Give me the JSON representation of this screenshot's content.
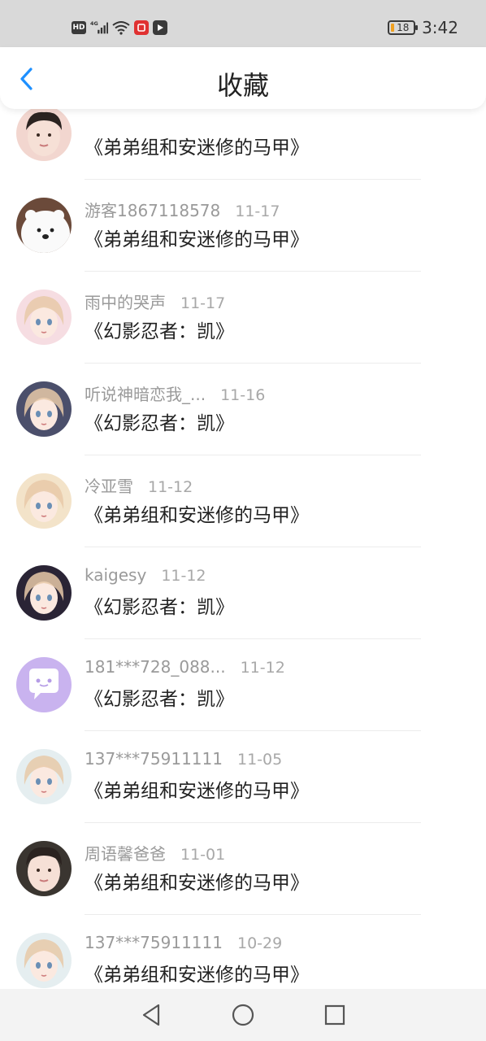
{
  "status_bar": {
    "hd_label": "HD",
    "network_label": "4G",
    "battery_level": "18",
    "time": "3:42"
  },
  "header": {
    "title": "收藏",
    "accent_color": "#1e90ff"
  },
  "items": [
    {
      "user": "",
      "date": "",
      "work": "《弟弟组和安迷修的马甲》",
      "avatar_color": "#f2d6cf",
      "avatar_icon": "photo-avatar-icon"
    },
    {
      "user": "游客1867118578",
      "date": "11-17",
      "work": "《弟弟组和安迷修的马甲》",
      "avatar_color": "#6b4a3a",
      "avatar_icon": "bear-avatar-icon"
    },
    {
      "user": "雨中的哭声",
      "date": "11-17",
      "work": "《幻影忍者：凯》",
      "avatar_color": "#f6dde2",
      "avatar_icon": "anime-avatar-icon"
    },
    {
      "user": "听说神暗恋我_...",
      "date": "11-16",
      "work": "《幻影忍者：凯》",
      "avatar_color": "#4b4f6b",
      "avatar_icon": "anime-avatar-icon"
    },
    {
      "user": "冷亚雪",
      "date": "11-12",
      "work": "《弟弟组和安迷修的马甲》",
      "avatar_color": "#f3e3c9",
      "avatar_icon": "anime-avatar-icon"
    },
    {
      "user": "kaigesy",
      "date": "11-12",
      "work": "《幻影忍者：凯》",
      "avatar_color": "#2a2435",
      "avatar_icon": "anime-avatar-icon"
    },
    {
      "user": "181***728_088...",
      "date": "11-12",
      "work": "《幻影忍者：凯》",
      "avatar_color": "#c9b3ef",
      "avatar_icon": "chat-bubble-icon"
    },
    {
      "user": "137***75911111",
      "date": "11-05",
      "work": "《弟弟组和安迷修的马甲》",
      "avatar_color": "#e5eef0",
      "avatar_icon": "anime-avatar-icon"
    },
    {
      "user": "周语馨爸爸",
      "date": "11-01",
      "work": "《弟弟组和安迷修的马甲》",
      "avatar_color": "#3a3530",
      "avatar_icon": "photo-avatar-icon"
    },
    {
      "user": "137***75911111",
      "date": "10-29",
      "work": "《弟弟组和安迷修的马甲》",
      "avatar_color": "#e5eef0",
      "avatar_icon": "anime-avatar-icon"
    }
  ]
}
